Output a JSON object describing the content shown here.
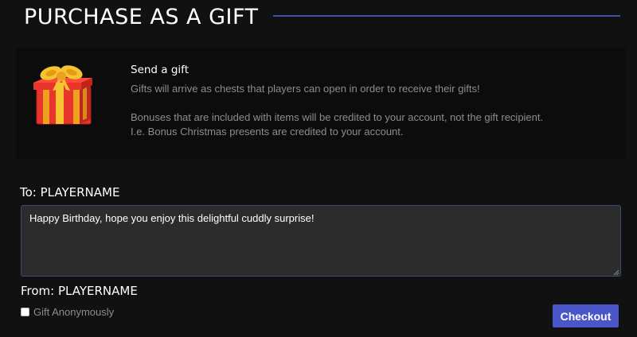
{
  "header": {
    "title": "PURCHASE AS A GIFT",
    "accent_color": "#3f4fb0"
  },
  "info": {
    "icon": "gift-box-icon",
    "title": "Send a gift",
    "line1": "Gifts will arrive as chests that players can open in order to receive their gifts!",
    "line2": "Bonuses that are included with items will be credited to your account, not the gift recipient.",
    "line3": "I.e. Bonus Christmas presents are credited to your account."
  },
  "form": {
    "to_label": "To: PLAYERNAME",
    "message_value": "Happy Birthday, hope you enjoy this delightful cuddly surprise!",
    "from_label": "From: PLAYERNAME",
    "anonymous_label": "Gift Anonymously",
    "anonymous_checked": false,
    "checkout_label": "Checkout",
    "checkout_color": "#4a55c8"
  }
}
